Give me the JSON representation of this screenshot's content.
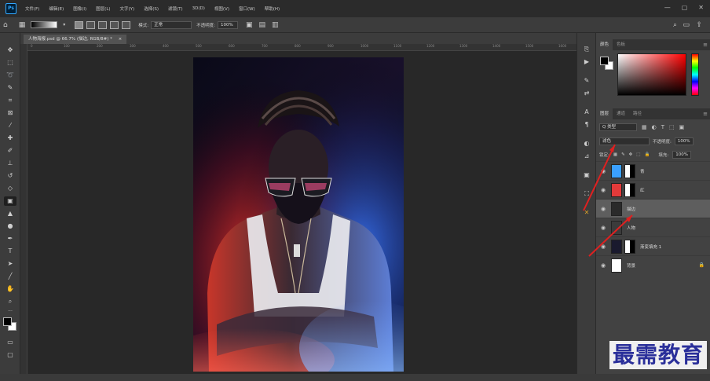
{
  "menubar": {
    "app_icon": "photoshop-logo",
    "app_label": "Ps",
    "items": [
      "文件(F)",
      "编辑(E)",
      "图像(I)",
      "图层(L)",
      "文字(Y)",
      "选择(S)",
      "滤镜(T)",
      "3D(D)",
      "视图(V)",
      "窗口(W)",
      "帮助(H)"
    ],
    "window_controls": [
      "minimize-icon",
      "maximize-icon",
      "close-icon"
    ]
  },
  "options_bar": {
    "home_icon": "home-icon",
    "mode_label": "模式:",
    "mode_value": "正常",
    "opacity_label": "不透明度:",
    "opacity_value": "100%"
  },
  "document_tab": {
    "title": "人物海报.psd @ 66.7% (描边, RGB/8#) *",
    "close": "×"
  },
  "ruler_ticks": [
    "0",
    "100",
    "200",
    "300",
    "400",
    "500",
    "600",
    "700",
    "800",
    "900",
    "1000",
    "1100",
    "1200",
    "1300",
    "1400",
    "1500",
    "1600"
  ],
  "tools": [
    "move-icon",
    "marquee-icon",
    "lasso-icon",
    "quick-select-icon",
    "crop-icon",
    "frame-icon",
    "eyedropper-icon",
    "healing-icon",
    "brush-icon",
    "stamp-icon",
    "history-brush-icon",
    "eraser-icon",
    "gradient-icon",
    "blur-icon",
    "dodge-icon",
    "pen-icon",
    "type-icon",
    "path-select-icon",
    "shape-icon",
    "hand-icon",
    "zoom-icon",
    "more-icon"
  ],
  "active_tool": "gradient-icon",
  "side_strip_icons": [
    "history-icon",
    "actions-icon",
    "brush-settings-icon",
    "adjustments-icon",
    "character-icon",
    "paragraph-icon",
    "styles-icon",
    "properties-icon",
    "libraries-icon",
    "channels-icon",
    "cross-tool-icon"
  ],
  "color_panel": {
    "tabs": [
      "颜色",
      "色板"
    ],
    "active_tab": "颜色"
  },
  "layers_panel": {
    "tabs": [
      "图层",
      "通道",
      "路径"
    ],
    "active_tab": "图层",
    "filter_label": "Q 类型",
    "blend_mode": "滤色",
    "opacity_label": "不透明度:",
    "opacity_value": "100%",
    "lock_label": "锁定:",
    "fill_label": "填充:",
    "fill_value": "100%",
    "layers": [
      {
        "name": "青",
        "visible": true,
        "thumb_color": "#3aa0ff",
        "has_mask": true,
        "selected": false
      },
      {
        "name": "红",
        "visible": true,
        "thumb_color": "#e33a3a",
        "has_mask": true,
        "selected": false
      },
      {
        "name": "描边",
        "visible": true,
        "thumb_color": "#2a2a2a",
        "has_mask": false,
        "selected": true
      },
      {
        "name": "人物",
        "visible": true,
        "thumb_color": "#3b3b3b",
        "has_mask": false,
        "selected": false
      },
      {
        "name": "渐变填充 1",
        "visible": true,
        "thumb_color": "#1a1a2e",
        "has_mask": true,
        "selected": false
      },
      {
        "name": "背景",
        "visible": true,
        "thumb_color": "#ffffff",
        "has_mask": false,
        "selected": false
      }
    ]
  },
  "colors": {
    "accent_red": "#e02020",
    "watermark": "#2a2f9a"
  },
  "watermark": {
    "text": "最需教育"
  }
}
